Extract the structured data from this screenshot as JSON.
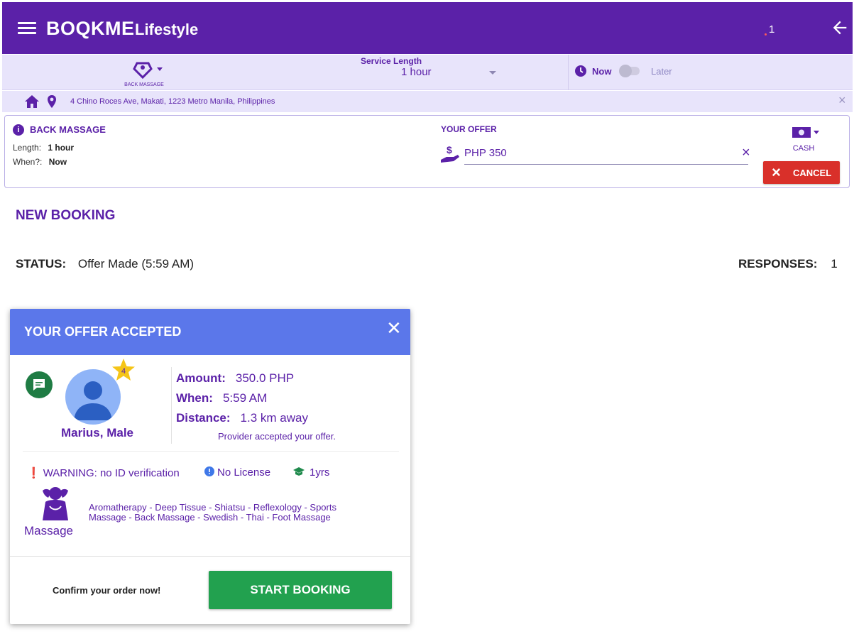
{
  "app": {
    "brand": "BOQKME",
    "brand_suffix": "Lifestyle",
    "notification_count": "1"
  },
  "options": {
    "service_name": "BACK MASSAGE",
    "service_length_caption": "Service Length",
    "service_length_value": "1 hour",
    "when_now": "Now",
    "when_later": "Later"
  },
  "address": {
    "text": "4 Chino Roces Ave, Makati, 1223 Metro Manila, Philippines"
  },
  "request": {
    "title": "BACK MASSAGE",
    "length_label": "Length:",
    "length_value": "1 hour",
    "when_label": "When?:",
    "when_value": "Now",
    "offer_caption": "YOUR OFFER",
    "offer_value": "PHP 350",
    "payment_label": "CASH",
    "cancel_label": "CANCEL"
  },
  "booking": {
    "title": "NEW BOOKING",
    "status_label": "STATUS:",
    "status_value": "Offer Made (5:59 AM)",
    "responses_label": "RESPONSES:",
    "responses_value": "1"
  },
  "dialog": {
    "title": "YOUR OFFER ACCEPTED",
    "rating": "4",
    "provider_name": "Marius, Male",
    "amount_label": "Amount:",
    "amount_value": "350.0 PHP",
    "when_label": "When:",
    "when_value": "5:59 AM",
    "distance_label": "Distance:",
    "distance_value": "1.3 km away",
    "note": "Provider accepted your offer.",
    "warning": "WARNING: no ID verification",
    "license": "No License",
    "experience": "1yrs",
    "category": "Massage",
    "skills_line1": "Aromatherapy - Deep Tissue - Shiatsu - Reflexology - Sports",
    "skills_line2": "Massage - Back Massage - Swedish - Thai - Foot Massage",
    "confirm_text": "Confirm your order now!",
    "start_label": "START BOOKING"
  },
  "colors": {
    "primary": "#5b21a8",
    "dialog_header": "#5b77ea",
    "cancel": "#d9302a",
    "start": "#22a14f",
    "chat": "#1f7c44"
  }
}
